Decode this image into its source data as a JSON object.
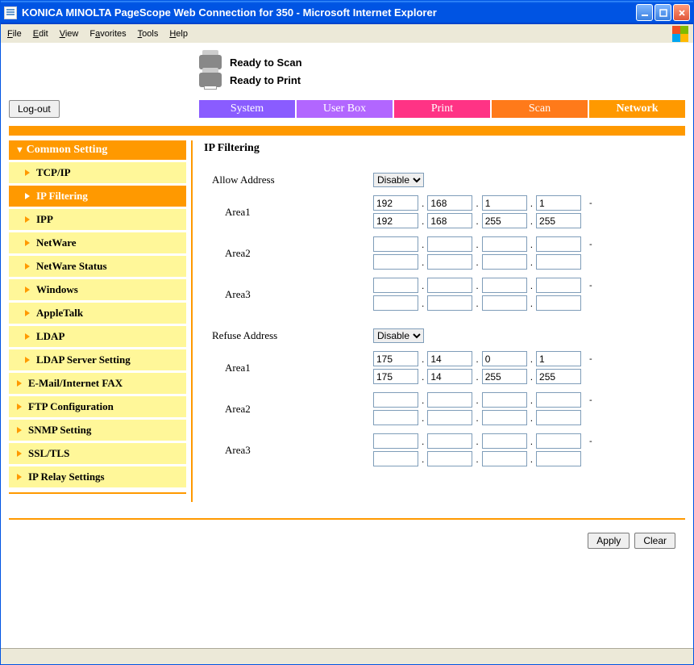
{
  "window": {
    "title": "KONICA MINOLTA PageScope Web Connection for 350 - Microsoft Internet Explorer"
  },
  "menubar": {
    "items": [
      "File",
      "Edit",
      "View",
      "Favorites",
      "Tools",
      "Help"
    ]
  },
  "status": {
    "scan": "Ready to Scan",
    "print": "Ready to Print"
  },
  "logout_label": "Log-out",
  "tabs": {
    "system": "System",
    "userbox": "User Box",
    "print": "Print",
    "scan": "Scan",
    "network": "Network"
  },
  "sidebar": {
    "header": "Common Setting",
    "items": [
      {
        "label": "TCP/IP",
        "sub": true
      },
      {
        "label": "IP Filtering",
        "sub": true,
        "active": true
      },
      {
        "label": "IPP",
        "sub": true
      },
      {
        "label": "NetWare",
        "sub": true
      },
      {
        "label": "NetWare Status",
        "sub": true
      },
      {
        "label": "Windows",
        "sub": true
      },
      {
        "label": "AppleTalk",
        "sub": true
      },
      {
        "label": "LDAP",
        "sub": true
      },
      {
        "label": "LDAP Server Setting",
        "sub": true
      },
      {
        "label": "E-Mail/Internet FAX"
      },
      {
        "label": "FTP Configuration"
      },
      {
        "label": "SNMP Setting"
      },
      {
        "label": "SSL/TLS"
      },
      {
        "label": "IP Relay Settings"
      }
    ]
  },
  "page_title": "IP Filtering",
  "allow": {
    "label": "Allow Address",
    "select": "Disable",
    "areas": [
      {
        "label": "Area1",
        "from": [
          "192",
          "168",
          "1",
          "1"
        ],
        "to": [
          "192",
          "168",
          "255",
          "255"
        ]
      },
      {
        "label": "Area2",
        "from": [
          "",
          "",
          "",
          ""
        ],
        "to": [
          "",
          "",
          "",
          ""
        ]
      },
      {
        "label": "Area3",
        "from": [
          "",
          "",
          "",
          ""
        ],
        "to": [
          "",
          "",
          "",
          ""
        ]
      }
    ]
  },
  "refuse": {
    "label": "Refuse Address",
    "select": "Disable",
    "areas": [
      {
        "label": "Area1",
        "from": [
          "175",
          "14",
          "0",
          "1"
        ],
        "to": [
          "175",
          "14",
          "255",
          "255"
        ]
      },
      {
        "label": "Area2",
        "from": [
          "",
          "",
          "",
          ""
        ],
        "to": [
          "",
          "",
          "",
          ""
        ]
      },
      {
        "label": "Area3",
        "from": [
          "",
          "",
          "",
          ""
        ],
        "to": [
          "",
          "",
          "",
          ""
        ]
      }
    ]
  },
  "buttons": {
    "apply": "Apply",
    "clear": "Clear"
  },
  "punct": {
    "dot": ".",
    "dash": "-"
  }
}
